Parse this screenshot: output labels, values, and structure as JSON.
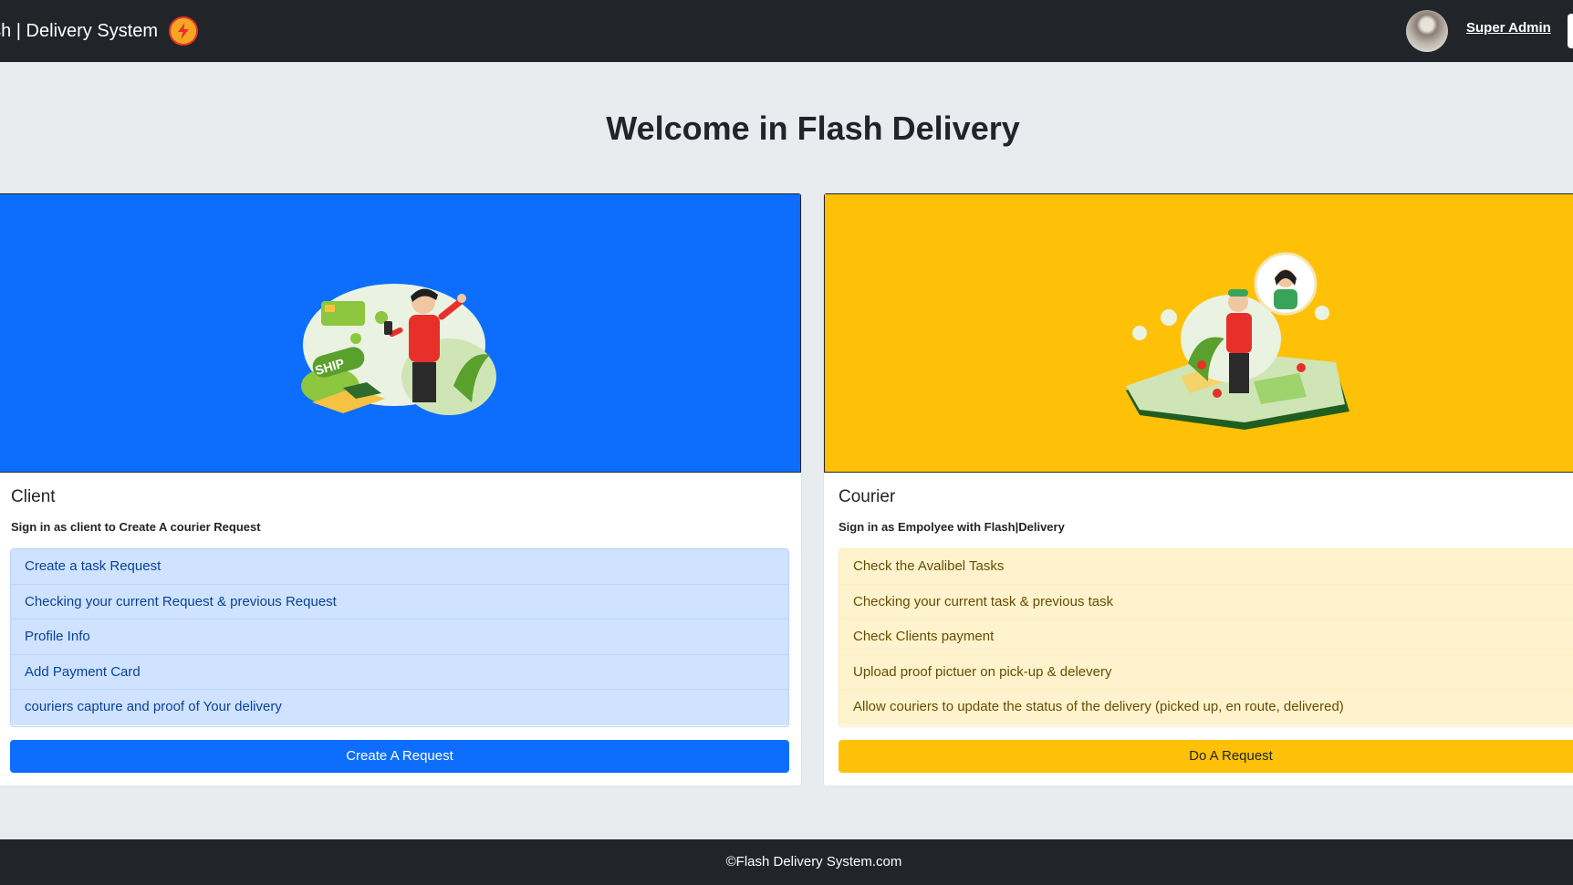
{
  "nav": {
    "brand": "ash | Delivery System",
    "user_name": "Super Admin"
  },
  "page": {
    "title": "Welcome in Flash Delivery"
  },
  "client_card": {
    "title": "Client",
    "subtitle": "Sign in as client to Create A courier Request",
    "items": [
      "Create a task Request",
      "Checking your current Request & previous Request",
      "Profile Info",
      "Add Payment Card",
      "couriers capture and proof of Your delivery"
    ],
    "button_label": "Create A Request",
    "hero_color": "#0d6efd"
  },
  "courier_card": {
    "title": "Courier",
    "subtitle": "Sign in as Empolyee with Flash|Delivery",
    "items": [
      "Check the Avalibel Tasks",
      "Checking your current task & previous task",
      "Check Clients payment",
      "Upload proof pictuer on pick-up & delevery",
      "Allow couriers to update the status of the delivery (picked up, en route, delivered)"
    ],
    "button_label": "Do A Request",
    "hero_color": "#ffc107"
  },
  "footer": {
    "text": "©Flash Delivery System.com"
  },
  "icons": {
    "brand_logo": "lightning-bolt-icon",
    "user_avatar": "avatar"
  }
}
